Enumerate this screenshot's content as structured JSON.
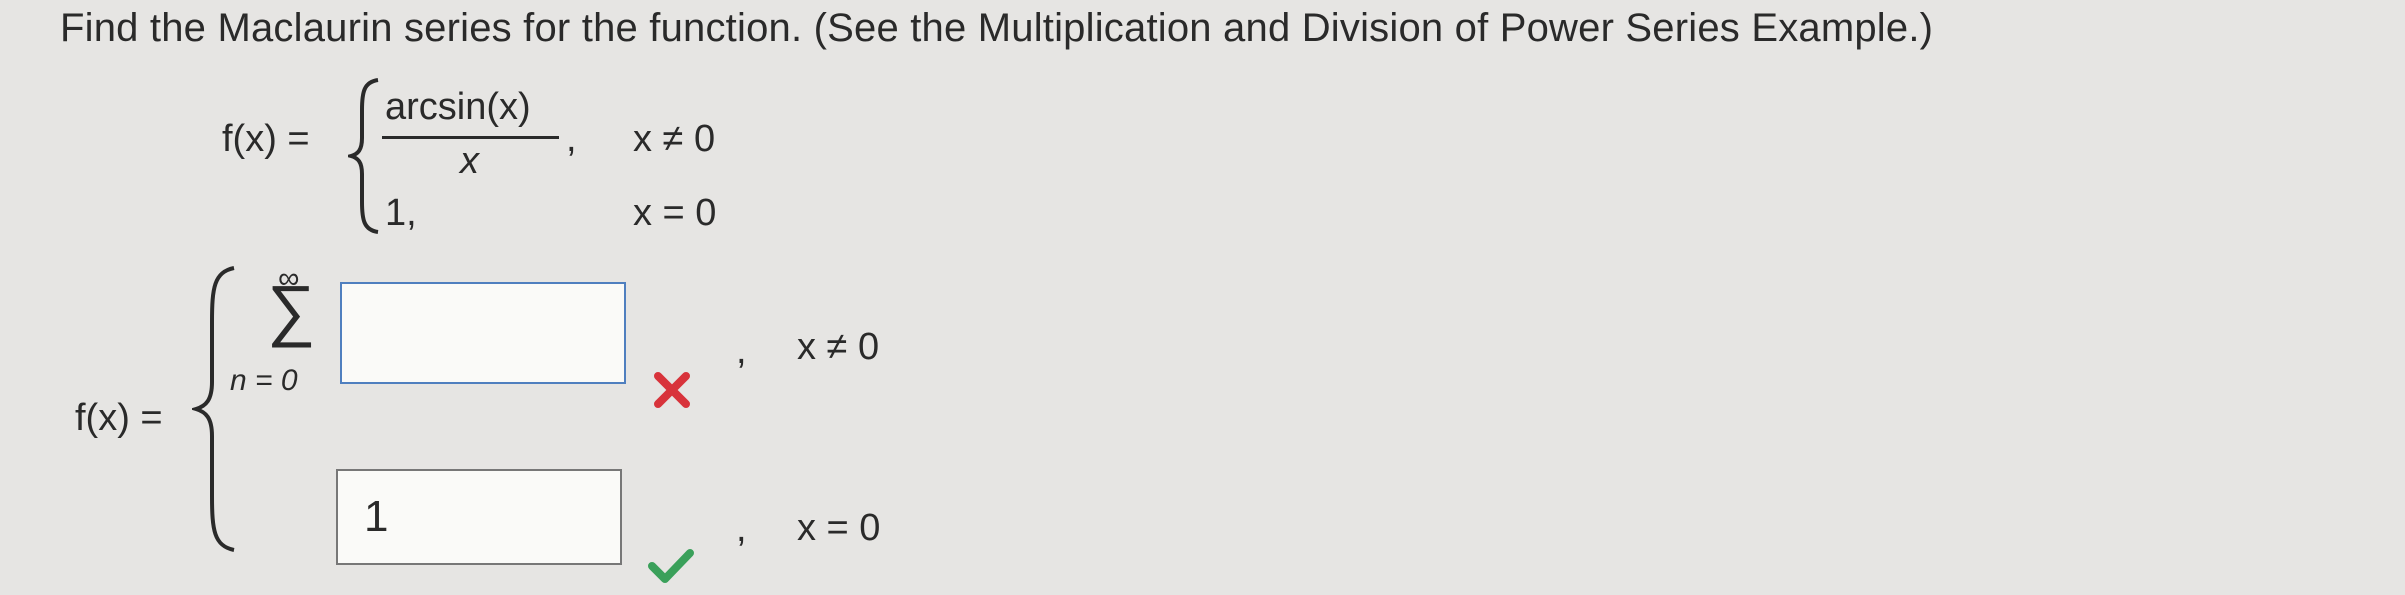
{
  "question": {
    "prompt": "Find the Maclaurin series for the function. (See the Multiplication and Division of Power Series Example.)"
  },
  "given_function": {
    "lhs": "f(x) =",
    "case1_numerator": "arcsin(x)",
    "case1_denominator": "x",
    "case1_comma": ",",
    "case1_condition": "x ≠ 0",
    "case2_value": "1,",
    "case2_condition": "x = 0"
  },
  "answer_function": {
    "lhs": "f(x) =",
    "sum_symbol": "∑",
    "sum_upper": "∞",
    "sum_lower": "n = 0",
    "case1_comma": ",",
    "case1_condition": "x ≠ 0",
    "case1_input_value": "",
    "case1_status": "incorrect",
    "case2_input_value": "1",
    "case2_comma": ",",
    "case2_condition": "x = 0",
    "case2_status": "correct"
  },
  "colors": {
    "background": "#e6e5e3",
    "incorrect_mark": "#d8333b",
    "correct_mark": "#3aa05a",
    "input_border_active": "#4f7fbf"
  }
}
